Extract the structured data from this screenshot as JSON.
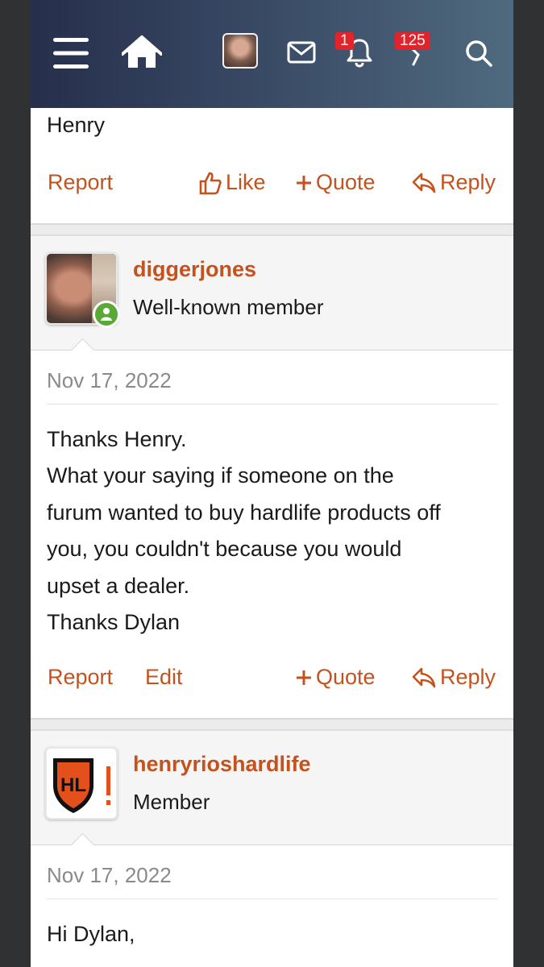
{
  "nav": {
    "alerts_badge": "1",
    "chat_badge": "125"
  },
  "previous_post": {
    "signature_text": "Henry",
    "actions": {
      "report": "Report",
      "like": "Like",
      "quote": "Quote",
      "reply": "Reply"
    }
  },
  "post1": {
    "username": "diggerjones",
    "user_title": "Well-known member",
    "date": "Nov 17, 2022",
    "lines": [
      "Thanks Henry.",
      "What your saying if someone on the",
      "furum wanted to buy hardlife products off",
      "you, you couldn't because you would",
      "upset a dealer.",
      "Thanks Dylan"
    ],
    "actions": {
      "report": "Report",
      "edit": "Edit",
      "quote": "Quote",
      "reply": "Reply"
    }
  },
  "post2": {
    "username": "henryrioshardlife",
    "user_title": "Member",
    "date": "Nov 17, 2022",
    "avatar_letters": "HL",
    "lines": [
      "Hi Dylan,"
    ]
  },
  "colors": {
    "accent": "#c4521d",
    "badge": "#e0242b",
    "online": "#5aa937"
  }
}
